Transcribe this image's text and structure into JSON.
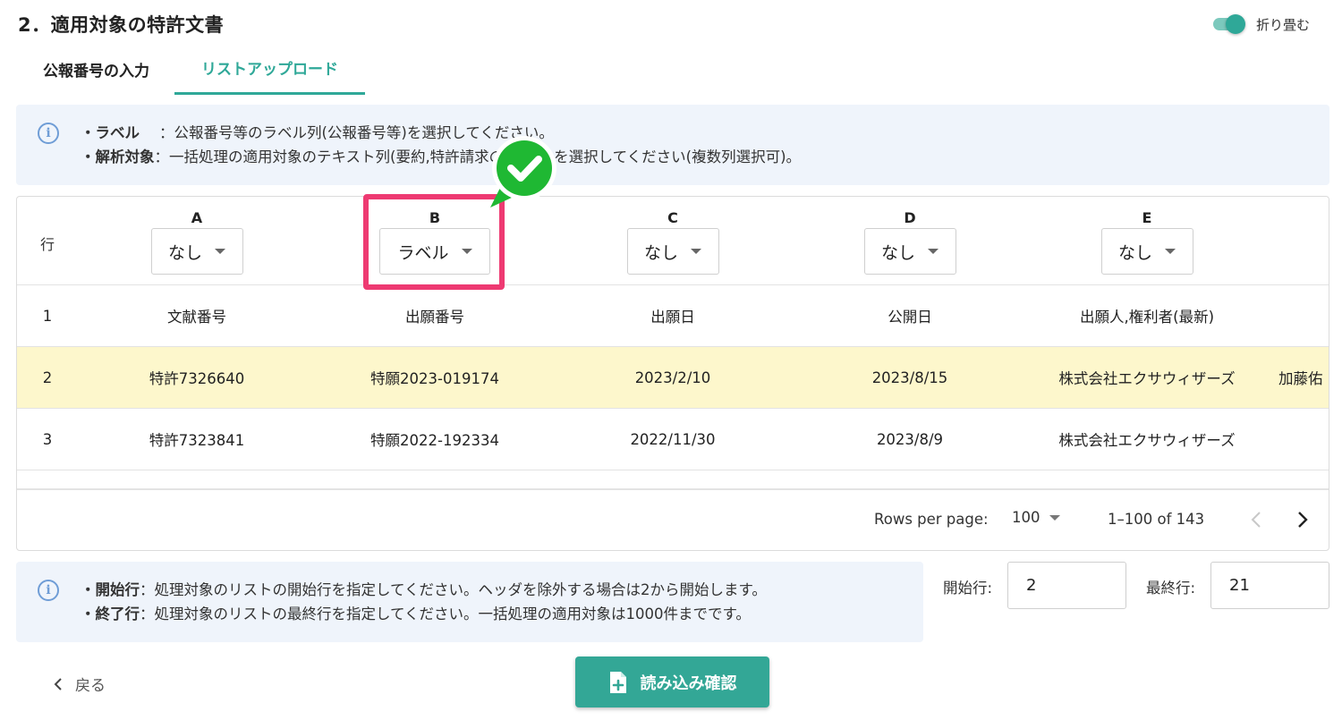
{
  "section": {
    "title": "2．適用対象の特許文書",
    "collapse_label": "折り畳む"
  },
  "tabs": [
    {
      "label": "公報番号の入力",
      "active": false
    },
    {
      "label": "リストアップロード",
      "active": true
    }
  ],
  "top_info": {
    "label_term": "・ラベル",
    "label_desc": "：公報番号等のラベル列(公報番号等)を選択してください。",
    "target_term": "・解析対象",
    "target_desc": "：一括処理の適用対象のテキスト列(要約,特許請求の範囲等)を選択してください(複数列選択可)。"
  },
  "table": {
    "row_header": "行",
    "columns": [
      {
        "letter": "A",
        "selected": "なし"
      },
      {
        "letter": "B",
        "selected": "ラベル"
      },
      {
        "letter": "C",
        "selected": "なし"
      },
      {
        "letter": "D",
        "selected": "なし"
      },
      {
        "letter": "E",
        "selected": "なし"
      }
    ],
    "rows": [
      {
        "num": "1",
        "cells": [
          "文献番号",
          "出願番号",
          "出願日",
          "公開日",
          "出願人,権利者(最新)",
          ""
        ]
      },
      {
        "num": "2",
        "cells": [
          "特許7326640",
          "特願2023-019174",
          "2023/2/10",
          "2023/8/15",
          "株式会社エクサウィザーズ",
          "加藤佑"
        ]
      },
      {
        "num": "3",
        "cells": [
          "特許7323841",
          "特願2022-192334",
          "2022/11/30",
          "2023/8/9",
          "株式会社エクサウィザーズ",
          ""
        ]
      }
    ]
  },
  "pagination": {
    "rows_per_page_label": "Rows per page:",
    "rows_per_page": "100",
    "range": "1–100 of 143"
  },
  "bottom_info": {
    "start_term": "・開始行",
    "start_desc": "：処理対象のリストの開始行を指定してください。ヘッダを除外する場合は2から開始します。",
    "end_term": "・終了行",
    "end_desc": "：処理対象のリストの最終行を指定してください。一括処理の適用対象は1000件までです。"
  },
  "range_fields": {
    "start_label": "開始行:",
    "start_value": "2",
    "end_label": "最終行:",
    "end_value": "21"
  },
  "footer": {
    "back_label": "戻る",
    "confirm_label": "読み込み確認"
  },
  "colors": {
    "accent": "#33a796",
    "highlight": "#ee3a72",
    "check": "#1fb833",
    "row_highlight": "#fdf7cc",
    "info_bg": "#eff4fb"
  }
}
